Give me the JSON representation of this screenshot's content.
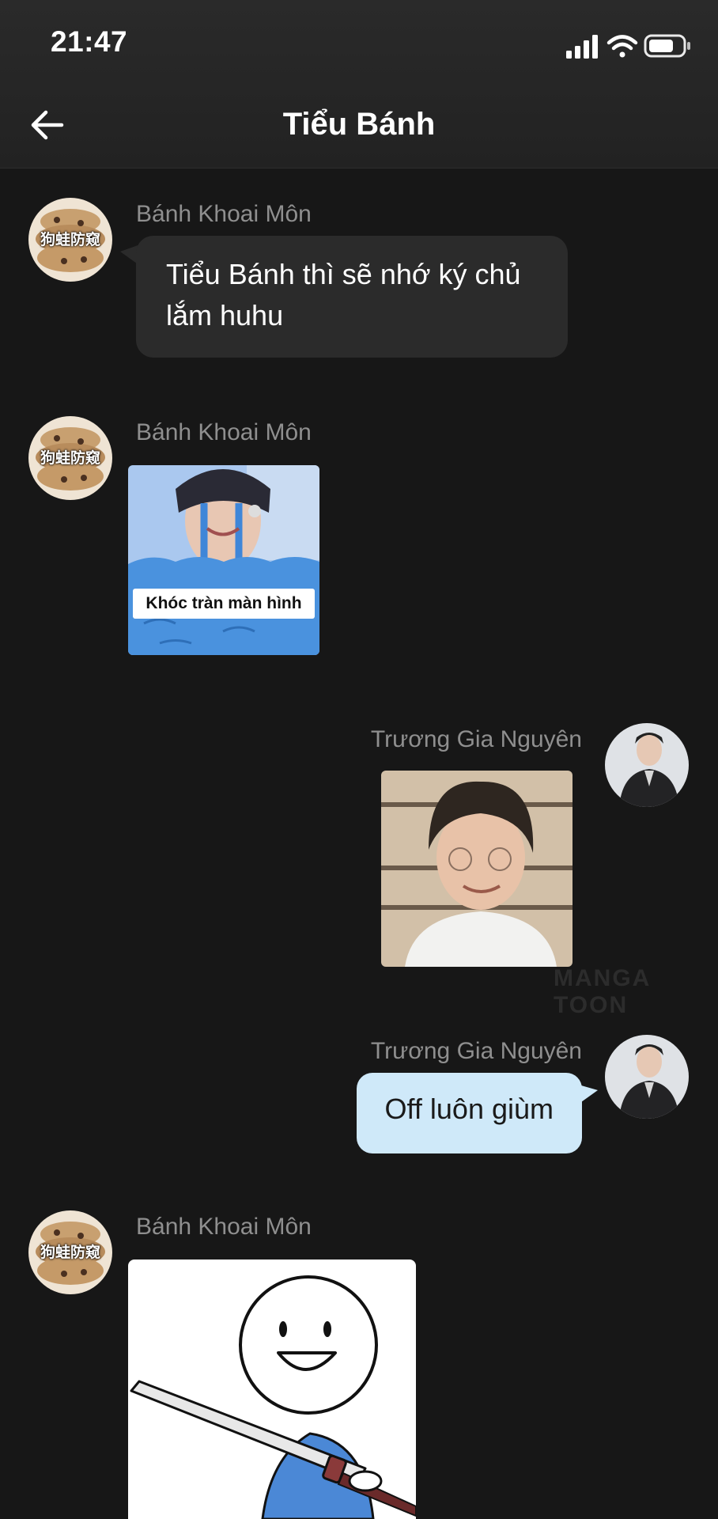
{
  "status_bar": {
    "time": "21:47"
  },
  "header": {
    "title": "Tiểu Bánh"
  },
  "messages": [
    {
      "sender": "Bánh Khoai Môn",
      "text": "Tiểu Bánh thì sẽ nhớ ký chủ lắm huhu"
    },
    {
      "sender": "Bánh Khoai Môn",
      "caption": "Khóc tràn màn hình"
    },
    {
      "sender": "Trương Gia Nguyên"
    },
    {
      "sender": "Trương Gia Nguyên",
      "text": "Off luôn giùm"
    },
    {
      "sender": "Bánh Khoai Môn"
    }
  ],
  "avatar_text": "狗蛙防窥",
  "watermark": "MANGA TOON",
  "colors": {
    "background": "#171717",
    "incoming_bubble": "#2b2b2b",
    "outgoing_bubble": "#cfe9f9",
    "sender_name": "#8f8f8f"
  }
}
